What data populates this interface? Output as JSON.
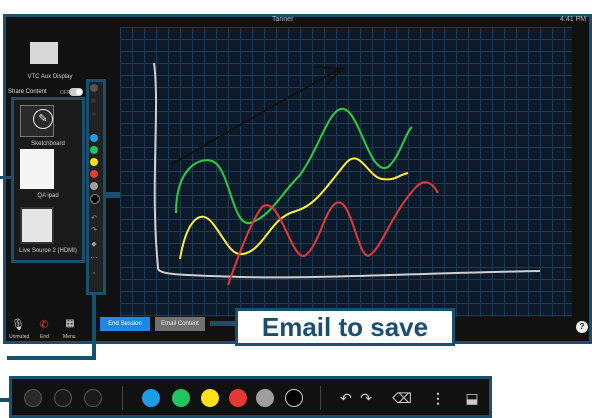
{
  "topbar": {
    "user": "Tanner",
    "time": "4:41 PM"
  },
  "sidebar": {
    "aux_display_label": "VTC Aux Display",
    "share_content_label": "Share Content",
    "share_toggle_state": "OFF",
    "sources": [
      {
        "label": "Sketchboard"
      },
      {
        "label": "QA ipad"
      },
      {
        "label": "Live Source 2 (HDMI)"
      }
    ]
  },
  "canvas_colors": {
    "black": "#111111",
    "green": "#2ecc40",
    "yellow": "#ffeb3b",
    "red": "#e53935",
    "gray": "#cfcfcf"
  },
  "pen_colors": [
    {
      "name": "blue",
      "hex": "#1e9be9"
    },
    {
      "name": "green",
      "hex": "#22c55e"
    },
    {
      "name": "yellow",
      "hex": "#ffe11a"
    },
    {
      "name": "red",
      "hex": "#e53935"
    },
    {
      "name": "gray",
      "hex": "#9e9e9e"
    },
    {
      "name": "black",
      "hex": "#000000"
    }
  ],
  "buttons": {
    "end_session": "End Session",
    "email_content": "Email Content",
    "help": "?"
  },
  "callout": {
    "email_to_save": "Email to save"
  },
  "controls": {
    "mute_label": "Unmuted",
    "end_label": "End",
    "menu_label": "Menu"
  },
  "icons": {
    "undo": "undo-icon",
    "redo": "redo-icon",
    "eraser": "eraser-icon",
    "more": "more-icon",
    "fullscreen": "minimize-icon",
    "pencil": "pencil-icon"
  }
}
